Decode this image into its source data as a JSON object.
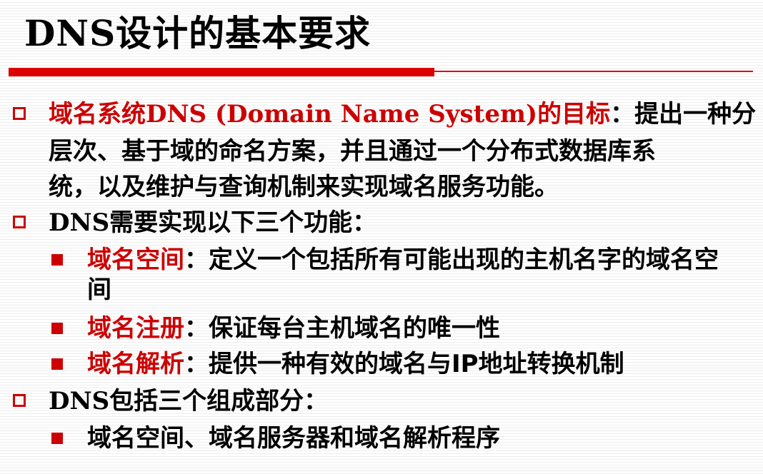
{
  "title": "DNS设计的基本要求",
  "bullet1": {
    "term": "域名系统DNS (Domain Name System)的目标",
    "line1_rest": "：提出一种分",
    "line2": "层次、基于域的命名方案，并且通过一个分布式数据库系",
    "line3": "统，以及维护与查询机制来实现域名服务功能。"
  },
  "bullet2": {
    "prefix": "DNS",
    "text": "需要实现以下三个功能：",
    "subs": [
      {
        "term": "域名空间",
        "text": "：定义一个包括所有可能出现的主机名字的域名空",
        "text2": "间"
      },
      {
        "term": "域名注册",
        "text": "：保证每台主机域名的唯一性"
      },
      {
        "term": "域名解析",
        "text": "：提供一种有效的域名与IP地址转换机制"
      }
    ]
  },
  "bullet3": {
    "prefix": "DNS",
    "text": "包括三个组成部分：",
    "subs": [
      {
        "text": "域名空间、域名服务器和域名解析程序"
      }
    ]
  },
  "colors": {
    "accent": "#cc0000"
  }
}
